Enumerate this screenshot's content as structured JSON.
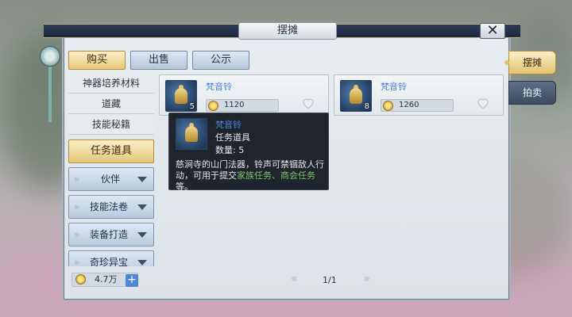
{
  "title": "摆摊",
  "close_symbol": "✕",
  "top_tabs": [
    {
      "label": "购买",
      "active": true
    },
    {
      "label": "出售",
      "active": false
    },
    {
      "label": "公示",
      "active": false
    }
  ],
  "sidebar": {
    "text_items": [
      "神器培养材料",
      "道藏",
      "技能秘籍"
    ],
    "active_item": "任务道具",
    "drop_items": [
      "伙伴",
      "技能法卷",
      "装备打造",
      "奇珍异宝"
    ]
  },
  "items": [
    {
      "name": "梵音铃",
      "qty": "5",
      "price": "1120"
    },
    {
      "name": "梵音铃",
      "qty": "8",
      "price": "1260"
    }
  ],
  "tooltip": {
    "name": "梵音铃",
    "type": "任务道具",
    "count": "数量: 5",
    "desc_part1": "慈涧寺的山门法器，铃声可禁锢敌人行动，可用于提交",
    "desc_highlight": "家族任务、商会任务",
    "desc_part2": "等。"
  },
  "footer": {
    "money": "4.7万",
    "plus_symbol": "+",
    "page": "1/1"
  },
  "side_tabs": [
    {
      "label": "摆摊",
      "active": true
    },
    {
      "label": "拍卖",
      "active": false
    }
  ],
  "icons": [
    "coin-icon",
    "heart-icon",
    "bell-item-icon",
    "dropdown-arrow-icon",
    "close-icon",
    "prev-page-icon",
    "next-page-icon"
  ],
  "colors": {
    "item_name": "#4a83d6",
    "highlight": "#7ac26a",
    "active_tab": "#e8c878"
  }
}
